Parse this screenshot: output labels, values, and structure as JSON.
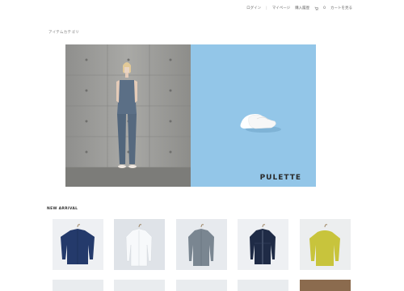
{
  "header": {
    "login": "ログイン",
    "account": "マイページ",
    "history": "購入履歴",
    "cart_count": "0",
    "cart": "カートを見る"
  },
  "category_link": "アイテムカテゴリ",
  "hero": {
    "brand": "PULETTE"
  },
  "new_arrival": {
    "title": "NEW ARRIVAL",
    "products": [
      {
        "icon": "navy-jacket",
        "color": "#243a6b"
      },
      {
        "icon": "white-shirt",
        "color": "#f4f6f8"
      },
      {
        "icon": "gray-shirt",
        "color": "#7a8691"
      },
      {
        "icon": "denim-jacket",
        "color": "#1f2b46"
      },
      {
        "icon": "yellow-sweater",
        "color": "#c8c43c"
      }
    ]
  }
}
